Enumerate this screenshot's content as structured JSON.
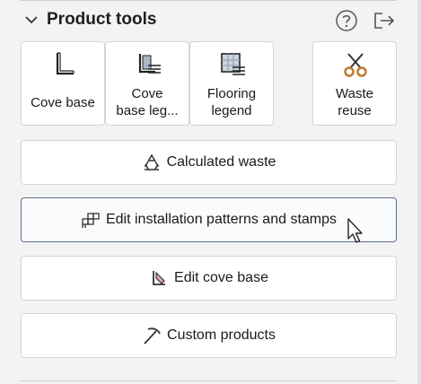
{
  "panel": {
    "title": "Product tools",
    "icons": {
      "collapse": "chevron-down-icon",
      "help": "help-icon",
      "exit": "exit-icon"
    }
  },
  "tiles": [
    {
      "label": "Cove base",
      "icon": "cove-base-icon"
    },
    {
      "label": "Cove\nbase leg...",
      "icon": "cove-base-legend-icon"
    },
    {
      "label": "Flooring\nlegend",
      "icon": "flooring-legend-icon"
    },
    {
      "label": "Waste\nreuse",
      "icon": "scissors-icon"
    }
  ],
  "buttons": [
    {
      "label": "Calculated waste",
      "icon": "recycle-icon"
    },
    {
      "label": "Edit installation patterns and stamps",
      "icon": "pattern-icon",
      "state": "hovered"
    },
    {
      "label": "Edit cove base",
      "icon": "cove-base-edit-icon"
    },
    {
      "label": "Custom products",
      "icon": "pickaxe-icon"
    }
  ],
  "colors": {
    "background": "#f3f3f3",
    "focus_border": "#5a6f86",
    "tile_border": "#d4d4d4"
  }
}
